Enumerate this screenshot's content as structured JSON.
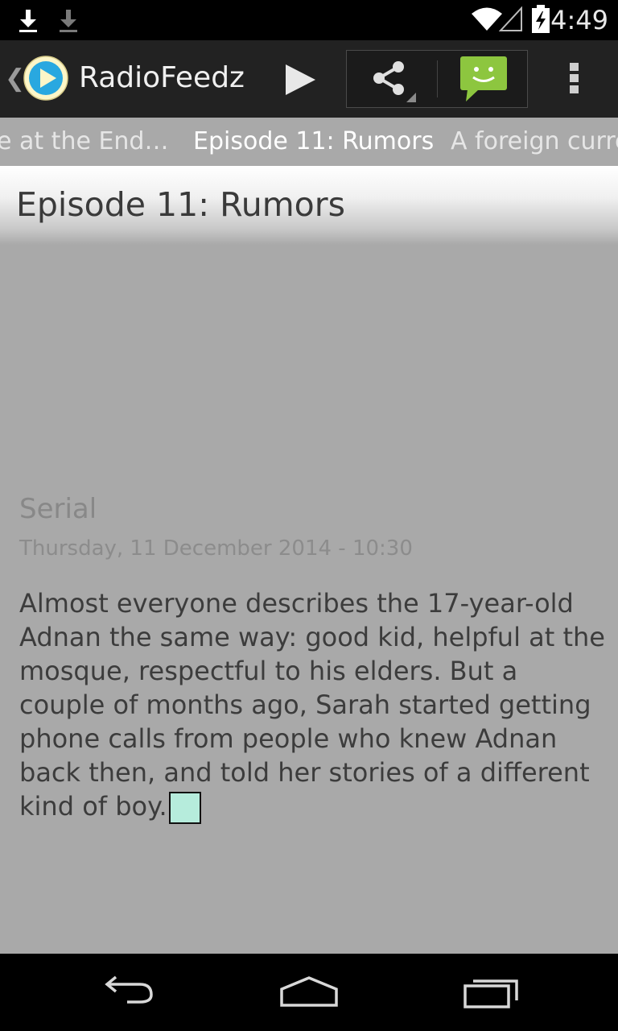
{
  "status_bar": {
    "time": "4:49",
    "icons": [
      "download-icon",
      "download-icon",
      "wifi-icon",
      "signal-icon",
      "battery-charging-icon"
    ]
  },
  "action_bar": {
    "app_title": "RadioFeedz",
    "app_icon": "radiofeedz-play-logo-icon",
    "actions": [
      "play-icon",
      "share-icon",
      "chat-message-icon",
      "overflow-menu-icon"
    ]
  },
  "tabs": {
    "previous": "e at the End…",
    "current": "Episode 11: Rumors",
    "next": "A foreign curre"
  },
  "episode": {
    "title": "Episode 11: Rumors",
    "show": "Serial",
    "date": "Thursday, 11 December 2014 - 10:30",
    "description": "Almost everyone describes the 17-year-old Adnan the same way: good kid, helpful at the mosque, respectful to his elders. But a couple of months ago, Sarah started getting phone calls from people who knew Adnan back then, and told her stories of a different kind of boy."
  },
  "colors": {
    "background": "#a9a9a9",
    "action_bar": "#222222",
    "accent_green": "#8dc63f",
    "logo_blue": "#29a8e0"
  },
  "nav_bar": {
    "buttons": [
      "back-icon",
      "home-icon",
      "recent-apps-icon"
    ]
  }
}
